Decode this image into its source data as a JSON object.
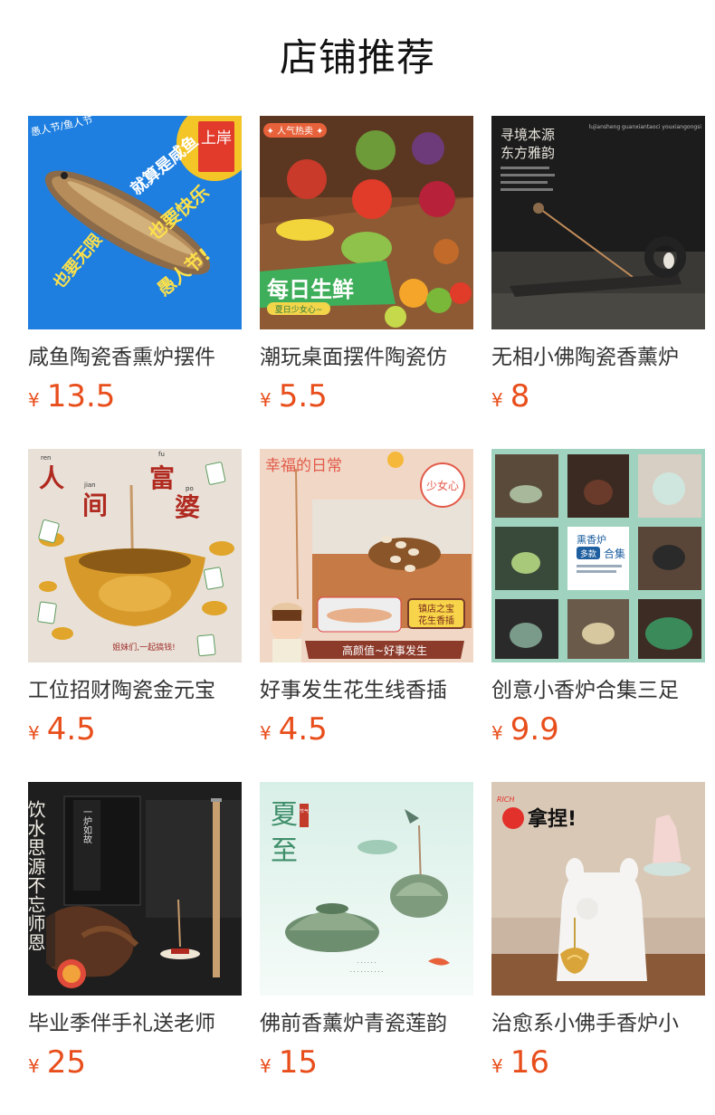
{
  "page": {
    "title": "店铺推荐"
  },
  "products": [
    {
      "name": "咸鱼陶瓷香熏炉摆件",
      "currency": "¥",
      "price": "13.5",
      "image": {
        "banner_left": "愚人节/鱼人节",
        "stamp": "上岸",
        "text_a": "就算是咸鱼",
        "text_b": "也要快乐",
        "text_c": "也要无限",
        "text_d": "愚人节!"
      }
    },
    {
      "name": "潮玩桌面摆件陶瓷仿",
      "currency": "¥",
      "price": "5.5",
      "image": {
        "tag": "✦ 人气热卖 ✦",
        "banner": "每日生鲜",
        "sub": "夏日少女心~"
      }
    },
    {
      "name": "无相小佛陶瓷香薰炉",
      "currency": "¥",
      "price": "8",
      "image": {
        "title_line1": "寻境本源",
        "title_line2": "东方雅韵",
        "pinyin": "lujiansheng guanxiantaoci youxiangongsi"
      }
    },
    {
      "name": "工位招财陶瓷金元宝",
      "currency": "¥",
      "price": "4.5",
      "image": {
        "char1": "人",
        "char2": "间",
        "char3": "富",
        "char4": "婆",
        "py1": "ren",
        "py2": "jian",
        "py3": "fu",
        "py4": "po",
        "caption": "姐妹们,一起搞钱!"
      }
    },
    {
      "name": "好事发生花生线香插",
      "currency": "¥",
      "price": "4.5",
      "image": {
        "title": "幸福的日常",
        "bubble": "少女心",
        "badge_line1": "镇店之宝",
        "badge_line2": "花生香插",
        "ribbon": "高颜值~好事发生"
      }
    },
    {
      "name": "创意小香炉合集三足",
      "currency": "¥",
      "price": "9.9",
      "image": {
        "center_line1": "熏香炉",
        "center_tag": "多款",
        "center_line2": "合集"
      }
    },
    {
      "name": "毕业季伴手礼送老师",
      "currency": "¥",
      "price": "25",
      "image": {
        "vertical_text": "饮水思源不忘师恩",
        "box_label": "一炉如故"
      }
    },
    {
      "name": "佛前香薰炉青瓷莲韵",
      "currency": "¥",
      "price": "15",
      "image": {
        "title_line1": "夏",
        "title_line2": "至",
        "seal": "节气"
      }
    },
    {
      "name": "治愈系小佛手香炉小",
      "currency": "¥",
      "price": "16",
      "image": {
        "rich": "RICH",
        "slogan": "拿捏!"
      }
    }
  ],
  "colors": {
    "price": "#e84e1b",
    "title": "#111111",
    "name": "#333333"
  }
}
